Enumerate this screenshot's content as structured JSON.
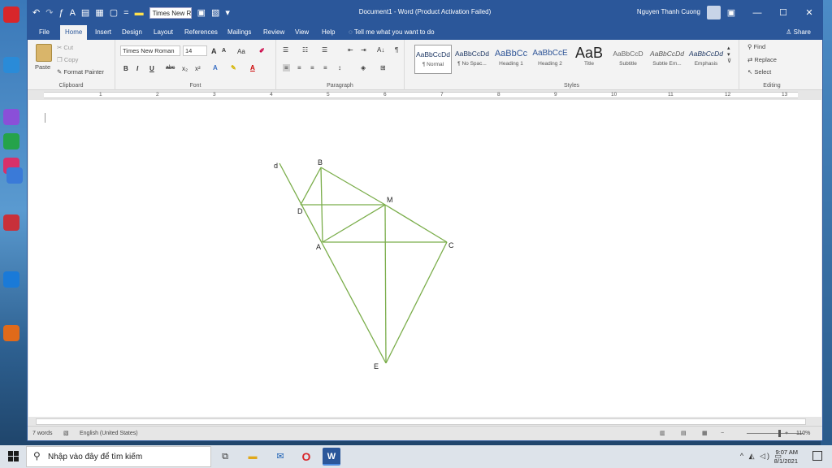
{
  "window": {
    "title": "Document1 - Word (Product Activation Failed)",
    "user": "Nguyen Thanh Cuong",
    "qat_font": "Times New R",
    "controls": [
      "▣",
      "—",
      "☐",
      "✕"
    ]
  },
  "tabs": [
    "File",
    "Home",
    "Insert",
    "Design",
    "Layout",
    "References",
    "Mailings",
    "Review",
    "View",
    "Help"
  ],
  "tell_me": "Tell me what you want to do",
  "share": "Share",
  "ribbon": {
    "clipboard": {
      "paste": "Paste",
      "cut": "Cut",
      "copy": "Copy",
      "format_painter": "Format Painter",
      "label": "Clipboard"
    },
    "font": {
      "name": "Times New Roman",
      "size": "14",
      "label": "Font",
      "buttons": [
        "B",
        "I",
        "U",
        "abc",
        "x₂",
        "x²"
      ],
      "grow": "A",
      "shrink": "A",
      "case": "Aa"
    },
    "paragraph": {
      "label": "Paragraph",
      "pilcrow": "¶",
      "sort": "A↓"
    },
    "styles": {
      "label": "Styles",
      "items": [
        {
          "preview": "AaBbCcDd",
          "name": "¶ Normal"
        },
        {
          "preview": "AaBbCcDd",
          "name": "¶ No Spac..."
        },
        {
          "preview": "AaBbCc",
          "name": "Heading 1"
        },
        {
          "preview": "AaBbCcE",
          "name": "Heading 2"
        },
        {
          "preview": "AaB",
          "name": "Title"
        },
        {
          "preview": "AaBbCcD",
          "name": "Subtitle"
        },
        {
          "preview": "AaBbCcDd",
          "name": "Subtle Em..."
        },
        {
          "preview": "AaBbCcDd",
          "name": "Emphasis"
        }
      ]
    },
    "editing": {
      "find": "Find",
      "replace": "Replace",
      "select": "Select",
      "label": "Editing"
    }
  },
  "ruler": {
    "numbers": [
      "1",
      "2",
      "3",
      "4",
      "5",
      "6",
      "7",
      "8",
      "9",
      "10",
      "11",
      "12",
      "13"
    ]
  },
  "figure": {
    "stroke_color": "#7aad4a",
    "points": {
      "d": {
        "label": "d"
      },
      "B": {
        "label": "B"
      },
      "D": {
        "label": "D"
      },
      "M": {
        "label": "M"
      },
      "A": {
        "label": "A"
      },
      "C": {
        "label": "C"
      },
      "E": {
        "label": "E"
      }
    }
  },
  "status": {
    "words": "7 words",
    "language": "English (United States)",
    "zoom": "110%",
    "zoom_minus": "−",
    "zoom_plus": "+"
  },
  "taskbar": {
    "search_placeholder": "Nhập vào đây để tìm kiếm",
    "time": "9:07 AM",
    "date": "8/1/2021",
    "tray": "^ ◭ ◁) ▭"
  }
}
